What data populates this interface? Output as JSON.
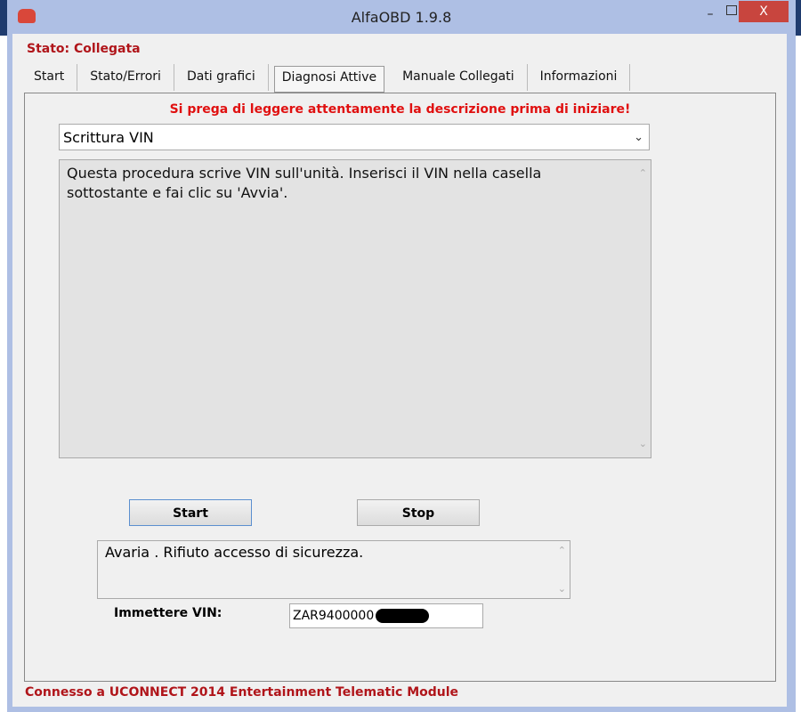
{
  "window": {
    "title": "AlfaOBD 1.9.8",
    "minimize": "–",
    "close": "X"
  },
  "status": "Stato: Collegata",
  "tabs": [
    {
      "label": "Start"
    },
    {
      "label": "Stato/Errori"
    },
    {
      "label": "Dati grafici"
    },
    {
      "label": "Diagnosi Attive",
      "active": true
    },
    {
      "label": "Manuale Collegati"
    },
    {
      "label": "Informazioni"
    }
  ],
  "panel": {
    "warning": "Si prega di leggere attentamente la descrizione prima di iniziare!",
    "procedure_select": "Scrittura VIN",
    "description": "Questa procedura scrive VIN sull'unità. Inserisci il VIN nella casella sottostante e fai clic su 'Avvia'.",
    "start_label": "Start",
    "stop_label": "Stop",
    "result": "Avaria . Rifiuto accesso di sicurezza.",
    "vin_label": "Immettere VIN:",
    "vin_value": "ZAR9400000"
  },
  "footer": "Connesso a UCONNECT 2014 Entertainment Telematic Module",
  "colors": {
    "status_red": "#b0151a",
    "warning_red": "#e01010",
    "close_red": "#c8453e",
    "frame": "#aebfe4"
  }
}
